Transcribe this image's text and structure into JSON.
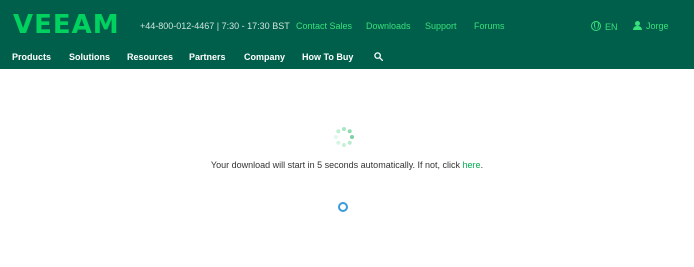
{
  "header": {
    "logo": "VEEAM",
    "phone": "+44-800-012-4467 | 7:30 - 17:30 BST",
    "links": [
      "Contact Sales",
      "Downloads",
      "Support",
      "Forums"
    ],
    "language": "EN",
    "user": "Jorge",
    "colors": {
      "background": "#005f4b",
      "accent": "#00d15f"
    }
  },
  "nav": {
    "items": [
      "Products",
      "Solutions",
      "Resources",
      "Partners",
      "Company",
      "How To Buy"
    ],
    "search_icon": "search-icon"
  },
  "main": {
    "message_prefix": "Your download will start in 5 seconds automatically. If not, click ",
    "link_text": "here",
    "message_suffix": "."
  }
}
